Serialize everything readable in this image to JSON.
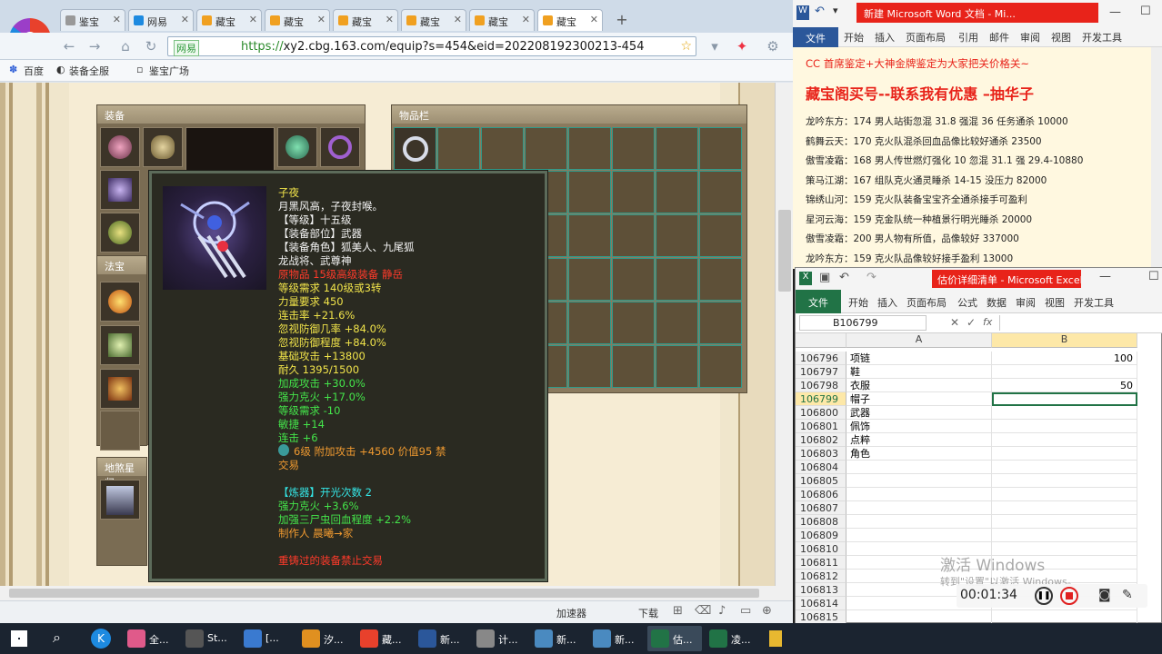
{
  "browser": {
    "tabs": [
      "鉴宝",
      "网易",
      "藏宝",
      "藏宝",
      "藏宝",
      "藏宝",
      "藏宝",
      "藏宝"
    ],
    "new_tab": "+",
    "url_security": "网易",
    "url_scheme": "https://",
    "url_rest": "xy2.cbg.163.com/equip?s=454&eid=202208192300213-454",
    "bookmarks": [
      "百度",
      "装备全服",
      "鉴宝广场"
    ],
    "status_items": [
      "加速器",
      "下载"
    ]
  },
  "game": {
    "equip_panel_title": "装备",
    "items_panel_title": "物品栏",
    "magic_panel_title": "法宝",
    "bottom_panel_title": "地煞星归"
  },
  "tooltip": {
    "lines": [
      {
        "text": "子夜",
        "color": "y"
      },
      {
        "text": "月黑风高，子夜封喉。",
        "color": "w"
      },
      {
        "text": "【等级】十五级",
        "color": "w"
      },
      {
        "text": "【装备部位】武器",
        "color": "w"
      },
      {
        "text": "【装备角色】狐美人、九尾狐",
        "color": "w"
      },
      {
        "text": "龙战将、武尊神",
        "color": "w"
      },
      {
        "text": "原物品 15级高级装备 静岳",
        "color": "r"
      },
      {
        "text": "等级需求 140级或3转",
        "color": "y"
      },
      {
        "text": "力量要求 450",
        "color": "y"
      },
      {
        "text": "连击率 +21.6%",
        "color": "y"
      },
      {
        "text": "忽视防御几率 +84.0%",
        "color": "y"
      },
      {
        "text": "忽视防御程度 +84.0%",
        "color": "y"
      },
      {
        "text": "基础攻击 +13800",
        "color": "y"
      },
      {
        "text": "耐久 1395/1500",
        "color": "y"
      },
      {
        "text": "加成攻击 +30.0%",
        "color": "g"
      },
      {
        "text": "强力克火 +17.0%",
        "color": "g"
      },
      {
        "text": "等级需求 -10",
        "color": "g"
      },
      {
        "text": "敏捷 +14",
        "color": "g"
      },
      {
        "text": "连击 +6",
        "color": "g"
      },
      {
        "text": "6级 附加攻击 +4560 价值95 禁",
        "color": "o"
      },
      {
        "text": "交易",
        "color": "o"
      },
      {
        "text": "",
        "color": "w"
      },
      {
        "text": "【炼器】开光次数 2",
        "color": "c"
      },
      {
        "text": "强力克火 +3.6%",
        "color": "g"
      },
      {
        "text": "加强三尸虫回血程度 +2.2%",
        "color": "g"
      },
      {
        "text": "制作人 晨曦→家",
        "color": "o"
      },
      {
        "text": "",
        "color": "w"
      },
      {
        "text": "重铸过的装备禁止交易",
        "color": "r"
      }
    ]
  },
  "word": {
    "doc_title": "新建 Microsoft Word 文档 - Mi...",
    "file_tab": "文件",
    "ribbon_tabs": [
      "开始",
      "插入",
      "页面布局",
      "引用",
      "邮件",
      "审阅",
      "视图",
      "开发工具"
    ],
    "lines": [
      {
        "text": "CC 首席鉴定+大神金牌鉴定为大家把关价格关~",
        "color": "#e8231a"
      },
      {
        "text": "藏宝阁买号--联系我有优惠 –抽华子",
        "color": "#e8231a"
      },
      {
        "text": "龙吟东方：174 男人站街忽混 31.8 强混 36 任务通杀 10000",
        "color": "#222"
      },
      {
        "text": "鹤舞云天：170 克火队混杀回血品像比较好通杀 23500",
        "color": "#222"
      },
      {
        "text": "傲雪凌霜：168 男人传世燃灯强化 10 忽混 31.1 强 29.4-10880",
        "color": "#222"
      },
      {
        "text": "策马江湖：167 组队克火通灵睡杀 14-15 没压力 82000",
        "color": "#222"
      },
      {
        "text": "锦绣山河：159 克火队装备宝宝齐全通杀接手可盈利",
        "color": "#222"
      },
      {
        "text": "星河云海：159 克金队统一种植景行明光睡杀 20000",
        "color": "#222"
      },
      {
        "text": "傲雪凌霜：200 男人物有所值，品像较好 337000",
        "color": "#222"
      },
      {
        "text": "龙吟东方：159 克火队品像较好接手盈利 13000",
        "color": "#222"
      }
    ]
  },
  "excel": {
    "doc_title": "估价详细清单 - Microsoft Excel(...",
    "file_tab": "文件",
    "ribbon_tabs": [
      "开始",
      "插入",
      "页面布局",
      "公式",
      "数据",
      "审阅",
      "视图",
      "开发工具"
    ],
    "name_box": "B106799",
    "fx": "fx",
    "col_a": "A",
    "col_b": "B",
    "rows": [
      {
        "n": "106796",
        "a": "项链",
        "b": "100"
      },
      {
        "n": "106797",
        "a": "鞋",
        "b": ""
      },
      {
        "n": "106798",
        "a": "衣服",
        "b": "50"
      },
      {
        "n": "106799",
        "a": "帽子",
        "b": ""
      },
      {
        "n": "106800",
        "a": "武器",
        "b": ""
      },
      {
        "n": "106801",
        "a": "佩饰",
        "b": ""
      },
      {
        "n": "106802",
        "a": "点粹",
        "b": ""
      },
      {
        "n": "106803",
        "a": "角色",
        "b": ""
      },
      {
        "n": "106804",
        "a": "",
        "b": ""
      },
      {
        "n": "106805",
        "a": "",
        "b": ""
      },
      {
        "n": "106806",
        "a": "",
        "b": ""
      },
      {
        "n": "106807",
        "a": "",
        "b": ""
      },
      {
        "n": "106808",
        "a": "",
        "b": ""
      },
      {
        "n": "106809",
        "a": "",
        "b": ""
      },
      {
        "n": "106810",
        "a": "",
        "b": ""
      },
      {
        "n": "106811",
        "a": "",
        "b": ""
      },
      {
        "n": "106812",
        "a": "",
        "b": ""
      },
      {
        "n": "106813",
        "a": "",
        "b": ""
      },
      {
        "n": "106814",
        "a": "",
        "b": ""
      },
      {
        "n": "106815",
        "a": "",
        "b": ""
      },
      {
        "n": "106816",
        "a": "",
        "b": ""
      },
      {
        "n": "106817",
        "a": "",
        "b": ""
      }
    ],
    "selected_row": "106799"
  },
  "overlay": {
    "activate": "激活 Windows",
    "activate_sub": "转到\"设置\"以激活 Windows。",
    "timer": "00:01:34"
  },
  "taskbar": {
    "items": [
      "全...",
      "St...",
      "[...",
      "汐...",
      "藏...",
      "新...",
      "计...",
      "新...",
      "新...",
      "估...",
      "凌..."
    ]
  }
}
